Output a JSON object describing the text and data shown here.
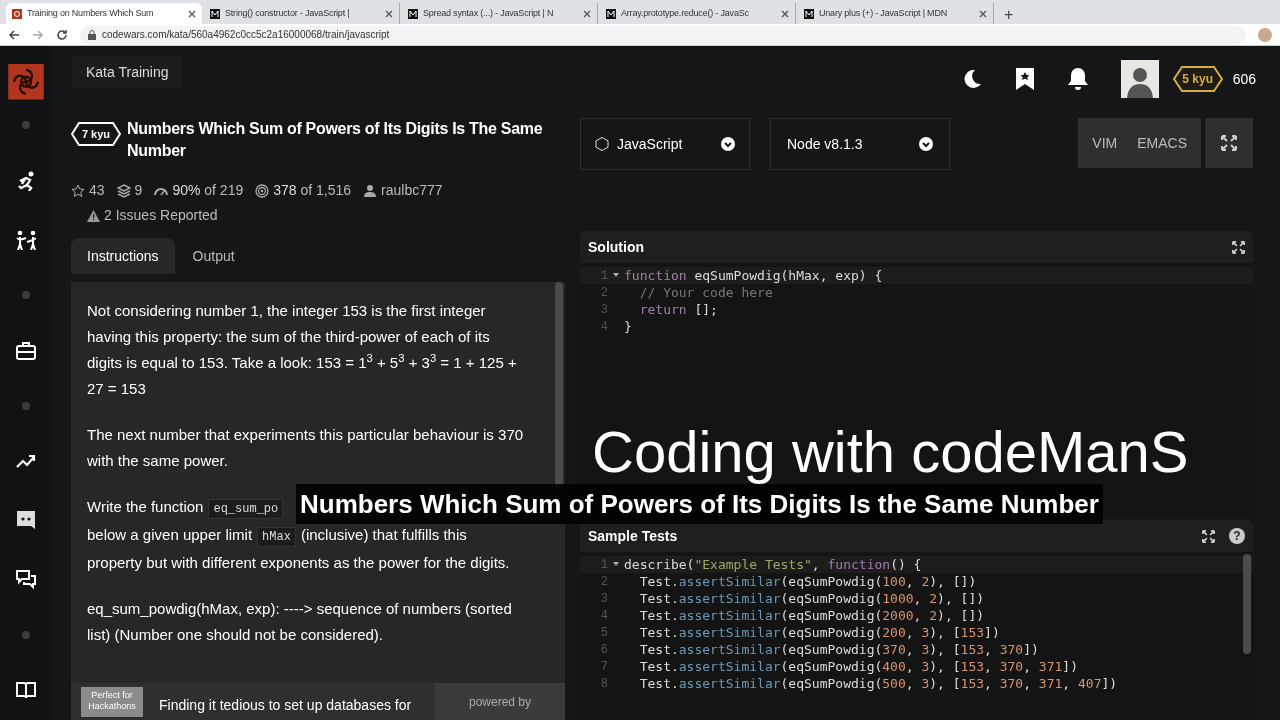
{
  "browser": {
    "tabs": [
      {
        "title": "Training on Numbers Which Sum",
        "selected": true,
        "kind": "codewars"
      },
      {
        "title": "String() constructor - JavaScript |",
        "selected": false,
        "kind": "mdn"
      },
      {
        "title": "Spread syntax (...) - JavaScript | N",
        "selected": false,
        "kind": "mdn"
      },
      {
        "title": "Array.prototype.reduce() - JavaSc",
        "selected": false,
        "kind": "mdn"
      },
      {
        "title": "Unary plus (+) - JavaScript | MDN",
        "selected": false,
        "kind": "mdn"
      }
    ],
    "new_tab": "+",
    "url": "codewars.com/kata/560a4962c0cc5c2a16000068/train/javascript"
  },
  "header": {
    "section": "Kata Training",
    "rank": "5 kyu",
    "honor": "606"
  },
  "sidebar": {
    "items": [
      {
        "kind": "dot"
      },
      {
        "kind": "runner"
      },
      {
        "kind": "fight"
      },
      {
        "kind": "dot"
      },
      {
        "kind": "briefcase"
      },
      {
        "kind": "dot"
      },
      {
        "kind": "trend"
      },
      {
        "kind": "discord"
      },
      {
        "kind": "chat"
      },
      {
        "kind": "dot"
      },
      {
        "kind": "book"
      }
    ]
  },
  "kata": {
    "rank": "7 kyu",
    "title": "Numbers Which Sum of Powers of Its Digits Is The Same Number",
    "stats": [
      {
        "kind": "star",
        "text": "43"
      },
      {
        "kind": "layers",
        "text": "9"
      },
      {
        "kind": "gauge",
        "text": "**90%** of 219"
      },
      {
        "kind": "target",
        "text": "**378** of 1,516"
      },
      {
        "kind": "user",
        "text": "raulbc777"
      }
    ],
    "issues": "2 Issues Reported",
    "tabs": [
      {
        "label": "Instructions",
        "selected": true
      },
      {
        "label": "Output",
        "selected": false
      }
    ],
    "paragraphs": [
      [
        {
          "kind": "text",
          "text": "Not considering number 1, the integer 153 is the first integer having this property: the sum of the third-power of each of its digits is equal to 153. Take a look: 153 = 1$^{3}$ + 5$^{3}$ + 3$^{3}$ = 1 + 125 + 27 = 153"
        }
      ],
      [
        {
          "kind": "text",
          "text": "The next number that experiments this particular behaviour is 370 with the same power."
        }
      ],
      [
        {
          "kind": "text",
          "text": "Write the function"
        },
        {
          "kind": "code",
          "text": "eq_sum_po"
        },
        {
          "kind": "break"
        },
        {
          "kind": "text",
          "text": "below a given upper limit"
        },
        {
          "kind": "code",
          "text": "hMax"
        },
        {
          "kind": "text",
          "text": "(inclusive) that fulfills this property but with different exponents as the power for the digits."
        }
      ],
      [
        {
          "kind": "text",
          "text": "eq_sum_powdig(hMax, exp): ----> sequence of numbers (sorted list) (Number one should not be considered)."
        }
      ]
    ],
    "ad": {
      "badge": "Perfect for Hackathons",
      "text": "Finding it tedious to set up databases for",
      "powered": "powered by"
    }
  },
  "editor": {
    "language": "JavaScript",
    "version": "Node v8.1.3",
    "modes": [
      "VIM",
      "EMACS"
    ],
    "solution": {
      "title": "Solution",
      "lines": [
        {
          "number": "1",
          "text": "function eqSumPowdig(hMax, exp) {",
          "foldable": true
        },
        {
          "number": "2",
          "text": "  // Your code here",
          "foldable": false
        },
        {
          "number": "3",
          "text": "  return [];",
          "foldable": false
        },
        {
          "number": "4",
          "text": "}",
          "foldable": false
        }
      ]
    },
    "tests": {
      "title": "Sample Tests",
      "help": "?",
      "lines": [
        {
          "number": "1",
          "text": "describe(\"Example Tests\", function() {",
          "foldable": true
        },
        {
          "number": "2",
          "text": "  Test.assertSimilar(eqSumPowdig(100, 2), [])",
          "foldable": false
        },
        {
          "number": "3",
          "text": "  Test.assertSimilar(eqSumPowdig(1000, 2), [])",
          "foldable": false
        },
        {
          "number": "4",
          "text": "  Test.assertSimilar(eqSumPowdig(2000, 2), [])",
          "foldable": false
        },
        {
          "number": "5",
          "text": "  Test.assertSimilar(eqSumPowdig(200, 3), [153])",
          "foldable": false
        },
        {
          "number": "6",
          "text": "  Test.assertSimilar(eqSumPowdig(370, 3), [153, 370])",
          "foldable": false
        },
        {
          "number": "7",
          "text": "  Test.assertSimilar(eqSumPowdig(400, 3), [153, 370, 371])",
          "foldable": false
        },
        {
          "number": "8",
          "text": "  Test.assertSimilar(eqSumPowdig(500, 3), [153, 370, 371, 407])",
          "foldable": false
        }
      ]
    }
  },
  "overlay": {
    "channel": "Coding with codeManS",
    "title": "Numbers Which Sum of Powers of Its Digits Is the Same Number"
  }
}
